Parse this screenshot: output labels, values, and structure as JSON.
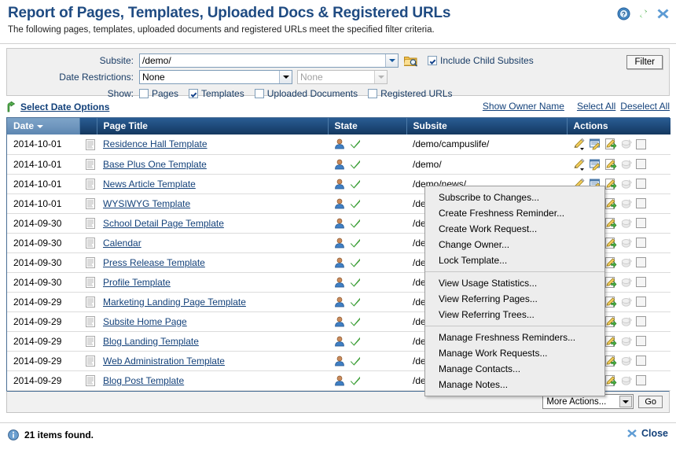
{
  "header": {
    "title": "Report of Pages, Templates, Uploaded Docs & Registered URLs",
    "subtitle": "The following pages, templates, uploaded documents and registered URLs meet the specified filter criteria.",
    "icons": [
      {
        "name": "help-icon",
        "glyph": "?"
      },
      {
        "name": "refresh-icon",
        "glyph": "⇄"
      },
      {
        "name": "close-window-icon",
        "glyph": "✖"
      }
    ]
  },
  "filter": {
    "subsite_label": "Subsite:",
    "subsite_value": "/demo/",
    "browse_icon": "folder-search-icon",
    "include_child_subsites_label": "Include Child Subsites",
    "include_child_subsites_checked": true,
    "date_restrictions_label": "Date Restrictions:",
    "date_restrictions_value": "None",
    "date_restrictions_value2": "None",
    "date_restrictions_secondary_disabled": true,
    "show_label": "Show:",
    "show_options": [
      {
        "label": "Pages",
        "checked": false
      },
      {
        "label": "Templates",
        "checked": true
      },
      {
        "label": "Uploaded Documents",
        "checked": false
      },
      {
        "label": "Registered URLs",
        "checked": false
      }
    ],
    "filter_button": "Filter"
  },
  "options_bar": {
    "select_date_options": "Select Date Options",
    "select_date_icon": "green-arrow-icon",
    "show_owner_name": "Show Owner Name",
    "select_all": "Select All",
    "deselect_all": "Deselect All"
  },
  "table": {
    "columns": [
      {
        "key": "date",
        "label": "Date",
        "sorted": true,
        "sort_dir": "desc"
      },
      {
        "key": "icon",
        "label": ""
      },
      {
        "key": "title",
        "label": "Page Title"
      },
      {
        "key": "state",
        "label": "State"
      },
      {
        "key": "subsite",
        "label": "Subsite"
      },
      {
        "key": "actions",
        "label": "Actions"
      }
    ],
    "rows": [
      {
        "date": "2014-10-01",
        "title": "Residence Hall Template",
        "subsite": "/demo/campuslife/"
      },
      {
        "date": "2014-10-01",
        "title": "Base Plus One Template",
        "subsite": "/demo/"
      },
      {
        "date": "2014-10-01",
        "title": "News Article Template",
        "subsite": "/demo/news/"
      },
      {
        "date": "2014-10-01",
        "title": "WYSIWYG Template",
        "subsite": "/de"
      },
      {
        "date": "2014-09-30",
        "title": "School Detail Page Template",
        "subsite": "/de"
      },
      {
        "date": "2014-09-30",
        "title": "Calendar",
        "subsite": "/de"
      },
      {
        "date": "2014-09-30",
        "title": "Press Release Template",
        "subsite": "/de"
      },
      {
        "date": "2014-09-30",
        "title": "Profile Template",
        "subsite": "/de"
      },
      {
        "date": "2014-09-29",
        "title": "Marketing Landing Page Template",
        "subsite": "/de"
      },
      {
        "date": "2014-09-29",
        "title": "Subsite Home Page",
        "subsite": "/de"
      },
      {
        "date": "2014-09-29",
        "title": "Blog Landing Template",
        "subsite": "/de"
      },
      {
        "date": "2014-09-29",
        "title": "Web Administration Template",
        "subsite": "/demo/webadmin/"
      },
      {
        "date": "2014-09-29",
        "title": "Blog Post Template",
        "subsite": "/demo/blog/"
      }
    ],
    "row_actions": [
      {
        "name": "edit-dropdown-icon"
      },
      {
        "name": "edit-properties-icon"
      },
      {
        "name": "publish-icon"
      },
      {
        "name": "preview-icon-disabled"
      },
      {
        "name": "select-row-checkbox"
      }
    ],
    "state_icons": [
      {
        "name": "owner-person-icon"
      },
      {
        "name": "published-check-icon"
      }
    ]
  },
  "table_footer": {
    "more_actions_value": "More Actions...",
    "go_button": "Go"
  },
  "context_menu": {
    "groups": [
      [
        "Subscribe to Changes...",
        "Create Freshness Reminder...",
        "Create Work Request...",
        "Change Owner...",
        "Lock Template..."
      ],
      [
        "View Usage Statistics...",
        "View Referring Pages...",
        "View Referring Trees..."
      ],
      [
        "Manage Freshness Reminders...",
        "Manage Work Requests...",
        "Manage Contacts...",
        "Manage Notes..."
      ]
    ]
  },
  "status": {
    "info_icon": "info-icon",
    "text": "21 items found.",
    "close_label": "Close",
    "close_icon": "close-x-icon"
  },
  "colors": {
    "title_blue": "#1F4B82",
    "link_blue": "#13417a",
    "header_grad_top": "#2a5d93",
    "header_grad_bottom": "#15395f",
    "sorted_header": "#7ea4c8",
    "panel_bg": "#f0f0f0",
    "menu_bg": "#ededed",
    "check_green": "#3a9e35"
  }
}
